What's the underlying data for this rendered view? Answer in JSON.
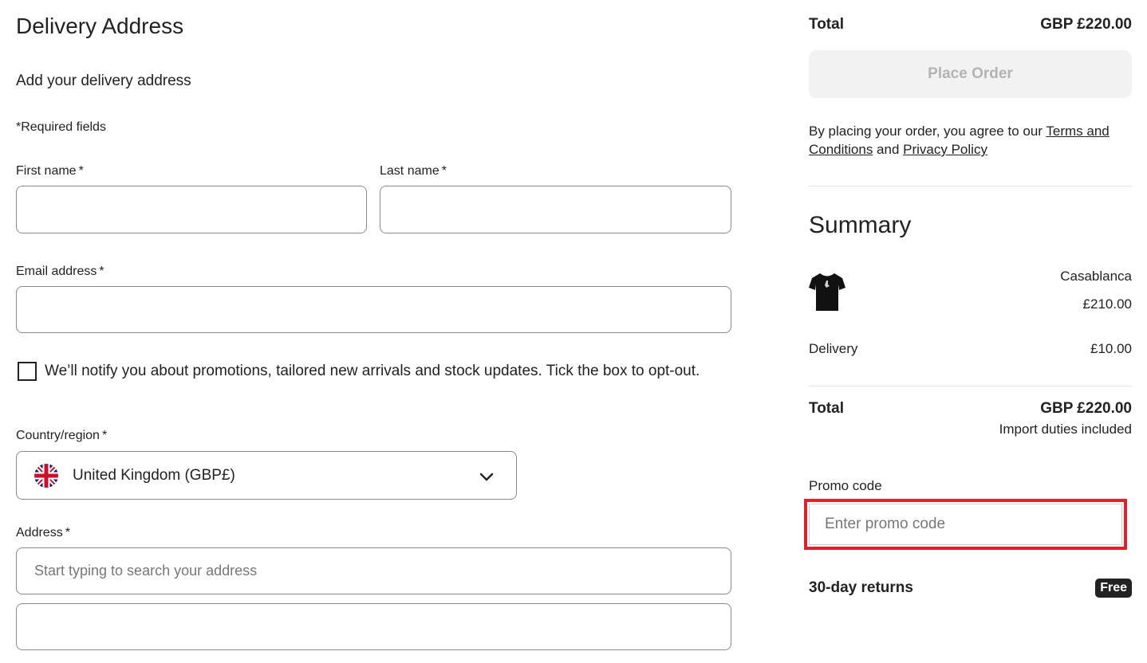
{
  "delivery": {
    "title": "Delivery Address",
    "subtitle": "Add your delivery address",
    "required_note": "*Required fields",
    "first_name_label": "First name",
    "last_name_label": "Last name",
    "email_label": "Email address",
    "required_marker": "*",
    "first_name_value": "",
    "last_name_value": "",
    "email_value": "",
    "notify_text": "We’ll notify you about promotions, tailored new arrivals and stock updates. Tick the box to opt-out.",
    "notify_checked": false,
    "country_label": "Country/region",
    "country_value": "United Kingdom (GBP£)",
    "country_flag_icon": "uk-flag-icon",
    "address_label": "Address",
    "address_placeholder": "Start typing to search your address",
    "address_line2_value": ""
  },
  "order": {
    "total_label": "Total",
    "total_value": "GBP £220.00",
    "place_order_label": "Place Order",
    "terms_prefix": "By placing your order, you agree to our ",
    "terms_link": "Terms and Conditions",
    "terms_and": " and ",
    "privacy_link": "Privacy Policy"
  },
  "summary": {
    "title": "Summary",
    "product": {
      "brand": "Casablanca",
      "price": "£210.00",
      "thumbnail_icon": "tshirt-icon"
    },
    "delivery_label": "Delivery",
    "delivery_value": "£10.00",
    "total_label": "Total",
    "total_value": "GBP £220.00",
    "duties_note": "Import duties included",
    "promo_label": "Promo code",
    "promo_placeholder": "Enter promo code",
    "returns_label": "30-day returns",
    "returns_badge": "Free"
  },
  "colors": {
    "highlight": "#e0202a",
    "disabled_button_bg": "#f2f2f2",
    "disabled_button_text": "#b3b3b3"
  }
}
